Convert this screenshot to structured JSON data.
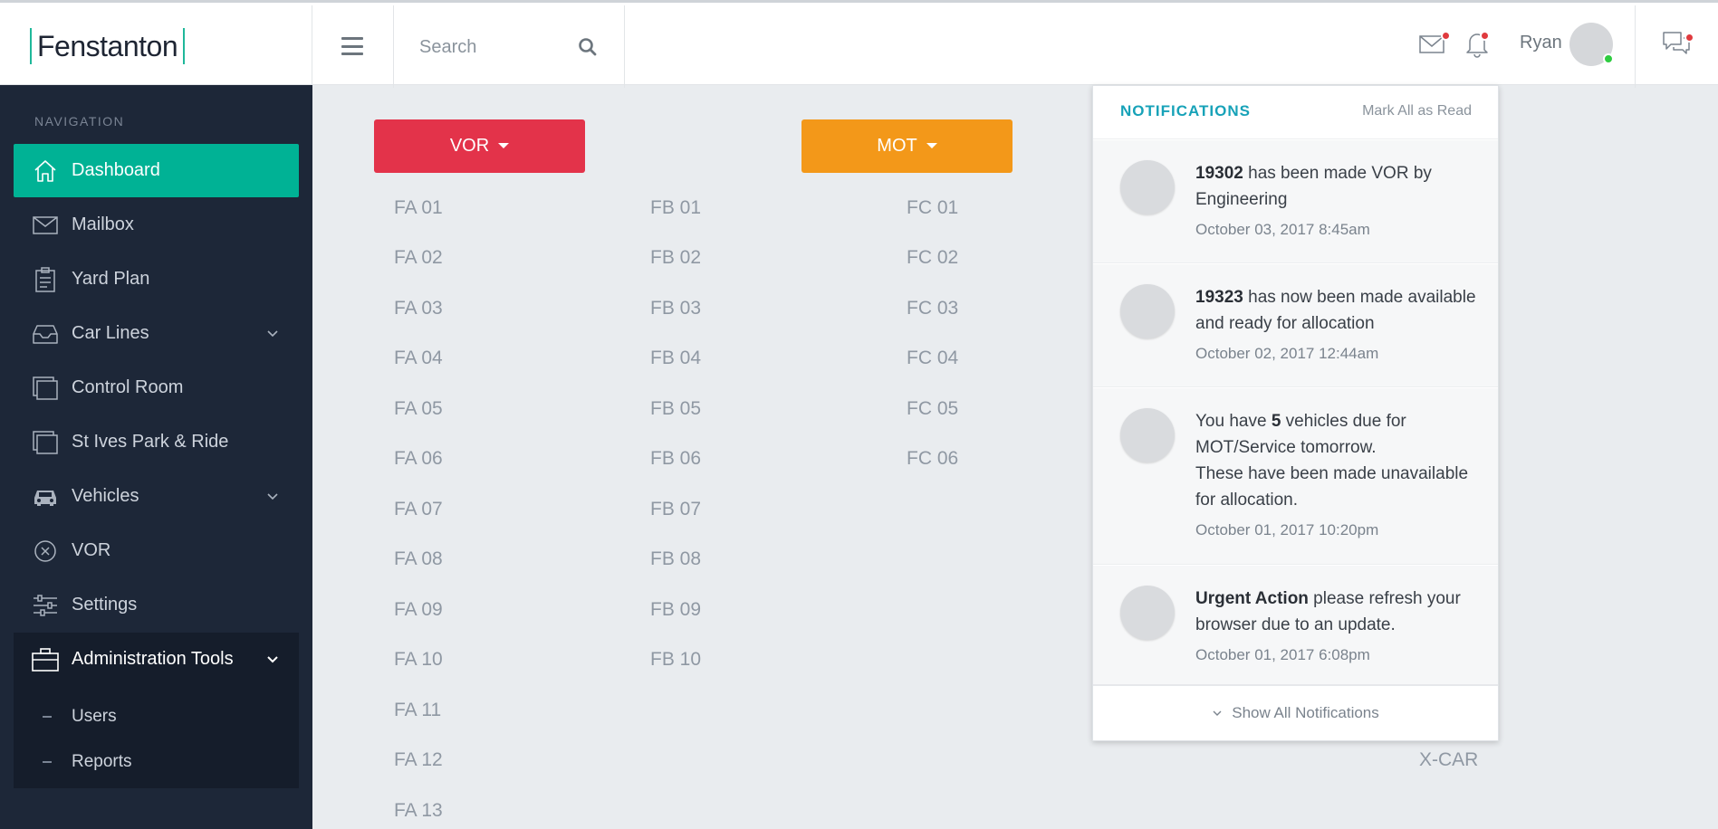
{
  "brand": {
    "name": "Fenstanton"
  },
  "search": {
    "placeholder": "Search"
  },
  "user": {
    "name": "Ryan"
  },
  "sidebar": {
    "heading": "NAVIGATION",
    "items": [
      {
        "label": "Dashboard",
        "icon": "home-icon"
      },
      {
        "label": "Mailbox",
        "icon": "envelope-icon"
      },
      {
        "label": "Yard Plan",
        "icon": "clipboard-icon"
      },
      {
        "label": "Car Lines",
        "icon": "inbox-tray-icon"
      },
      {
        "label": "Control Room",
        "icon": "windows-icon"
      },
      {
        "label": "St Ives Park & Ride",
        "icon": "windows-icon"
      },
      {
        "label": "Vehicles",
        "icon": "car-icon"
      },
      {
        "label": "VOR",
        "icon": "circle-x-icon"
      },
      {
        "label": "Settings",
        "icon": "sliders-icon"
      },
      {
        "label": "Administration Tools",
        "icon": "briefcase-icon"
      }
    ],
    "subitems": [
      {
        "label": "Users"
      },
      {
        "label": "Reports"
      }
    ]
  },
  "main": {
    "vor_label": "VOR",
    "mot_label": "MOT",
    "colors": {
      "vor": "#e3334a",
      "mot": "#f39819",
      "accent": "#00b295"
    },
    "col_fa": [
      "FA 01",
      "FA 02",
      "FA 03",
      "FA 04",
      "FA 05",
      "FA 06",
      "FA 07",
      "FA 08",
      "FA 09",
      "FA 10",
      "FA 11",
      "FA 12",
      "FA 13"
    ],
    "col_fb": [
      "FB 01",
      "FB 02",
      "FB 03",
      "FB 04",
      "FB 05",
      "FB 06",
      "FB 07",
      "FB 08",
      "FB 09",
      "FB 10"
    ],
    "col_fc": [
      "FC 01",
      "FC 02",
      "FC 03",
      "FC 04",
      "FC 05",
      "FC 06"
    ],
    "xcar": "X-CAR"
  },
  "notifications": {
    "title": "NOTIFICATIONS",
    "mark_all": "Mark All as Read",
    "show_all": "Show All Notifications",
    "items": [
      {
        "bold": "19302",
        "text": " has been made VOR by Engineering",
        "time": "October 03, 2017 8:45am"
      },
      {
        "bold": "19323",
        "text": " has now been made available and ready for allocation",
        "time": "October 02, 2017 12:44am"
      },
      {
        "pre": "You have ",
        "bold": "5",
        "text": " vehicles due for MOT/Service tomorrow.",
        "text2": "These have been made unavailable for allocation.",
        "time": "October 01, 2017 10:20pm"
      },
      {
        "bold": "Urgent Action",
        "text": " please refresh your browser due to an update.",
        "time": "October 01, 2017 6:08pm"
      }
    ]
  }
}
